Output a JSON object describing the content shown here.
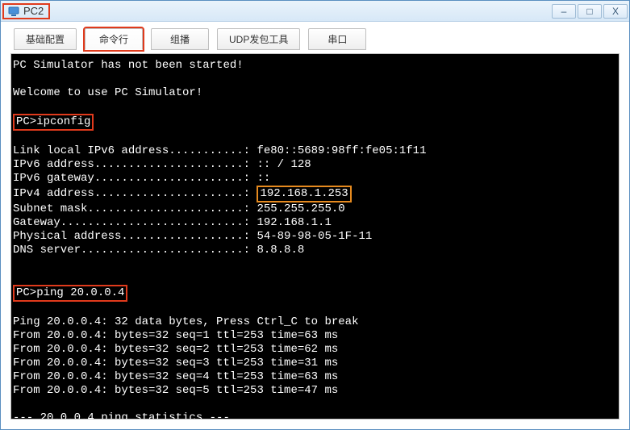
{
  "window": {
    "title": "PC2",
    "buttons": {
      "min": "–",
      "max": "□",
      "close": "X"
    }
  },
  "tabs": {
    "basic": "基础配置",
    "cmdline": "命令行",
    "multicast": "组播",
    "udp": "UDP发包工具",
    "serial": "串口"
  },
  "terminal": {
    "line1": "PC Simulator has not been started!",
    "line2": "Welcome to use PC Simulator!",
    "prompt1": "PC>ipconfig",
    "ipconfig": {
      "linklocal": "Link local IPv6 address...........: fe80::5689:98ff:fe05:1f11",
      "ipv6addr": "IPv6 address......................: :: / 128",
      "ipv6gw": "IPv6 gateway......................: ::",
      "ipv4label": "IPv4 address......................: ",
      "ipv4value": "192.168.1.253",
      "subnet": "Subnet mask.......................: 255.255.255.0",
      "gateway": "Gateway...........................: 192.168.1.1",
      "phys": "Physical address..................: 54-89-98-05-1F-11",
      "dns": "DNS server........................: 8.8.8.8"
    },
    "prompt2": "PC>ping 20.0.0.4",
    "ping": {
      "head": "Ping 20.0.0.4: 32 data bytes, Press Ctrl_C to break",
      "r1": "From 20.0.0.4: bytes=32 seq=1 ttl=253 time=63 ms",
      "r2": "From 20.0.0.4: bytes=32 seq=2 ttl=253 time=62 ms",
      "r3": "From 20.0.0.4: bytes=32 seq=3 ttl=253 time=31 ms",
      "r4": "From 20.0.0.4: bytes=32 seq=4 ttl=253 time=63 ms",
      "r5": "From 20.0.0.4: bytes=32 seq=5 ttl=253 time=47 ms",
      "stats": "--- 20.0.0.4 ping statistics ---"
    }
  }
}
